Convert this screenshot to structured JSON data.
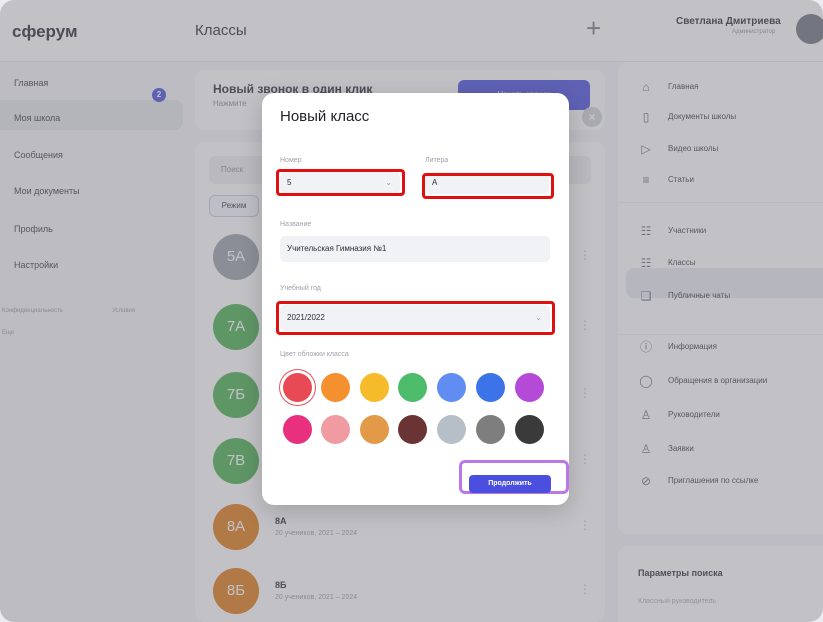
{
  "app": {
    "logo": "сферум",
    "page_title": "Классы"
  },
  "user": {
    "name": "Светлана Дмитриева",
    "role": "Администратор"
  },
  "left_nav": {
    "items": [
      {
        "label": "Главная"
      },
      {
        "label": "Моя школа"
      },
      {
        "label": "Сообщения"
      },
      {
        "label": "Мои документы"
      },
      {
        "label": "Профиль"
      },
      {
        "label": "Настройки"
      }
    ],
    "messages_badge": "2",
    "footer_links": [
      "Конфиденциальность",
      "Условия",
      "Еще"
    ]
  },
  "banner": {
    "title": "Новый звонок в один клик",
    "subtitle": "Нажмите",
    "button": "Начать звонок"
  },
  "list": {
    "search_placeholder": "Поиск",
    "filter_chip": "Режим",
    "rows": [
      {
        "initials": "5А",
        "name": "",
        "sub": "",
        "color": "#9aa0a8"
      },
      {
        "initials": "7А",
        "name": "",
        "sub": "",
        "color": "#4caf50"
      },
      {
        "initials": "7Б",
        "name": "",
        "sub": "",
        "color": "#4caf50"
      },
      {
        "initials": "7В",
        "name": "",
        "sub": "",
        "color": "#4caf50"
      },
      {
        "initials": "8А",
        "name": "8А",
        "sub": "20 учеников, 2021 – 2024",
        "color": "#e07a15"
      },
      {
        "initials": "8Б",
        "name": "8Б",
        "sub": "20 учеников, 2021 – 2024",
        "color": "#e07a15"
      }
    ]
  },
  "right_nav": {
    "items": [
      {
        "icon": "home-icon",
        "glyph": "⌂",
        "label": "Главная"
      },
      {
        "icon": "documents-icon",
        "glyph": "▯",
        "label": "Документы школы"
      },
      {
        "icon": "video-icon",
        "glyph": "▷",
        "label": "Видео школы"
      },
      {
        "icon": "article-icon",
        "glyph": "≡",
        "label": "Статьи"
      },
      {
        "icon": "members-icon",
        "glyph": "☷",
        "label": "Участники"
      },
      {
        "icon": "classes-icon",
        "glyph": "☷",
        "label": "Классы"
      },
      {
        "icon": "chats-icon",
        "glyph": "❏",
        "label": "Публичные чаты"
      },
      {
        "icon": "info-icon",
        "glyph": "ⓘ",
        "label": "Информация"
      },
      {
        "icon": "message-icon",
        "glyph": "◯",
        "label": "Обращения в организации"
      },
      {
        "icon": "person-icon",
        "glyph": "♙",
        "label": "Руководители"
      },
      {
        "icon": "person-add-icon",
        "glyph": "♙",
        "label": "Заявки"
      },
      {
        "icon": "link-icon",
        "glyph": "⊘",
        "label": "Приглашения по ссылке"
      }
    ],
    "search_params": {
      "title": "Параметры поиска",
      "sub": "Классный руководитель"
    }
  },
  "modal": {
    "title": "Новый класс",
    "number_label": "Номер",
    "number_value": "5",
    "letter_label": "Литера",
    "letter_value": "А",
    "name_label": "Название",
    "name_value": "Учительская Гимназия №1",
    "year_label": "Учебный год",
    "year_value": "2021/2022",
    "color_label": "Цвет обложки класса",
    "colors": [
      "#e84a55",
      "#f5902f",
      "#f6bb2b",
      "#4cbb6a",
      "#5f8df2",
      "#3c73e8",
      "#b54ad9",
      "#e8307f",
      "#ef9ba1",
      "#e39a48",
      "#6a3434",
      "#b6bec8",
      "#7e7e7e",
      "#3a3a3a"
    ],
    "continue_button": "Продолжить"
  }
}
